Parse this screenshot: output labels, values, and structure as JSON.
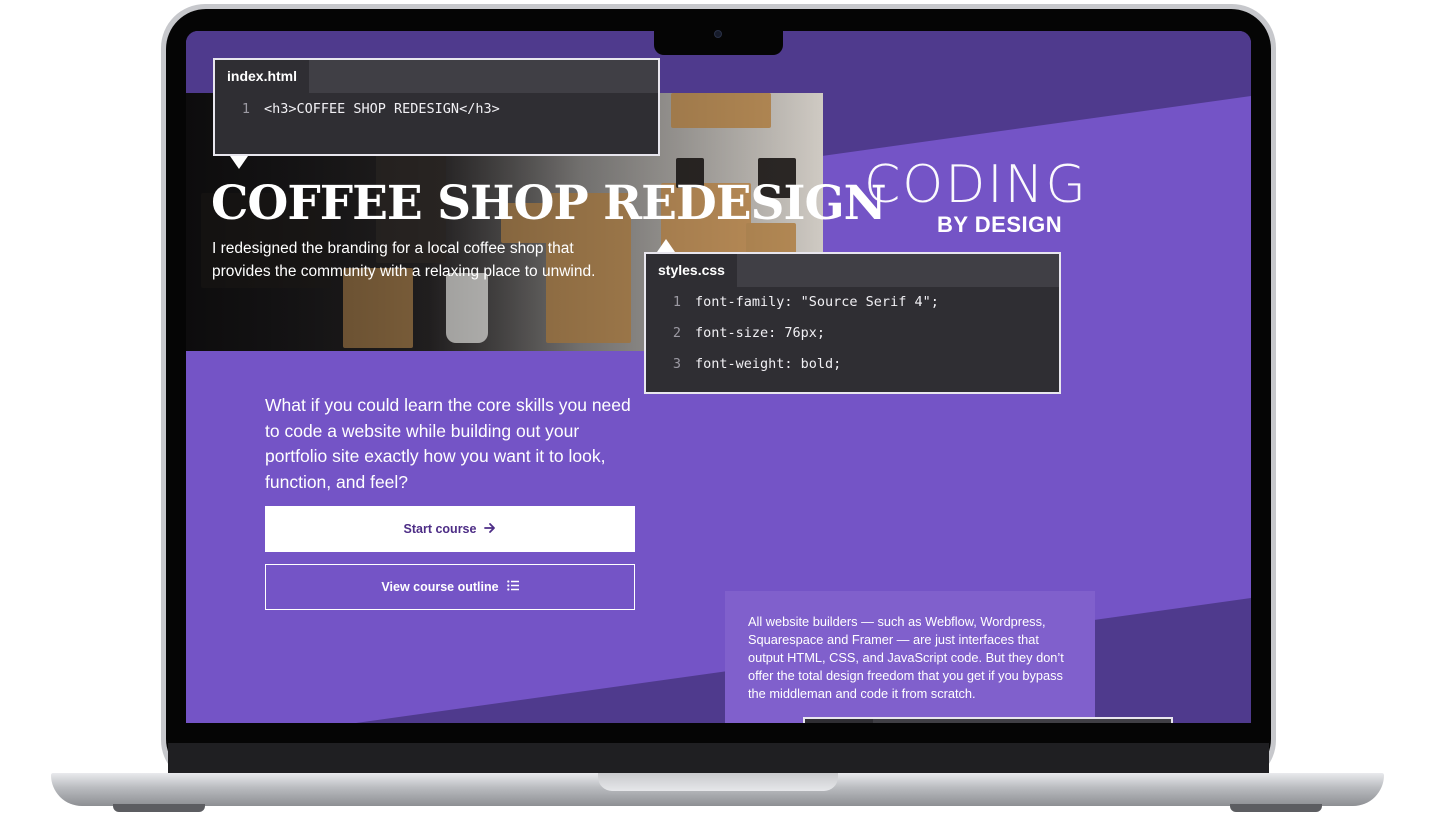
{
  "index_window": {
    "tab": "index.html",
    "lines": [
      {
        "num": "1",
        "code": "<h3>COFFEE SHOP REDESIGN</h3>"
      }
    ]
  },
  "hero": {
    "title": "COFFEE SHOP REDESIGN",
    "subtitle": "I redesigned the  branding for a local coffee shop that provides the community with a relaxing place to unwind."
  },
  "logo": {
    "line1": "CODING",
    "line2": "BY DESIGN"
  },
  "styles_window": {
    "tab": "styles.css",
    "lines": [
      {
        "num": "1",
        "code": "font-family: \"Source Serif 4\";"
      },
      {
        "num": "2",
        "code": "font-size: 76px;"
      },
      {
        "num": "3",
        "code": "font-weight: bold;"
      }
    ]
  },
  "intro": {
    "text": "What if you could learn the core skills you need to code a website while building out your portfolio site exactly how you want it to look, function, and feel?"
  },
  "buttons": {
    "start": "Start course",
    "outline": "View course outline"
  },
  "info_card": {
    "text": "All website builders — such as Webflow, Wordpress, Squarespace and Framer — are just interfaces that output HTML, CSS, and JavaScript code. But they don’t offer the total design freedom that you get if you bypass the middleman and code it from scratch."
  },
  "colors": {
    "primary_purple": "#7454c6",
    "dark_purple": "#4f3a8d",
    "code_bg": "#2f2e33",
    "start_button_text": "#4d2d86"
  },
  "icons": {
    "start_button": "arrow-right-icon",
    "outline_button": "list-icon"
  }
}
